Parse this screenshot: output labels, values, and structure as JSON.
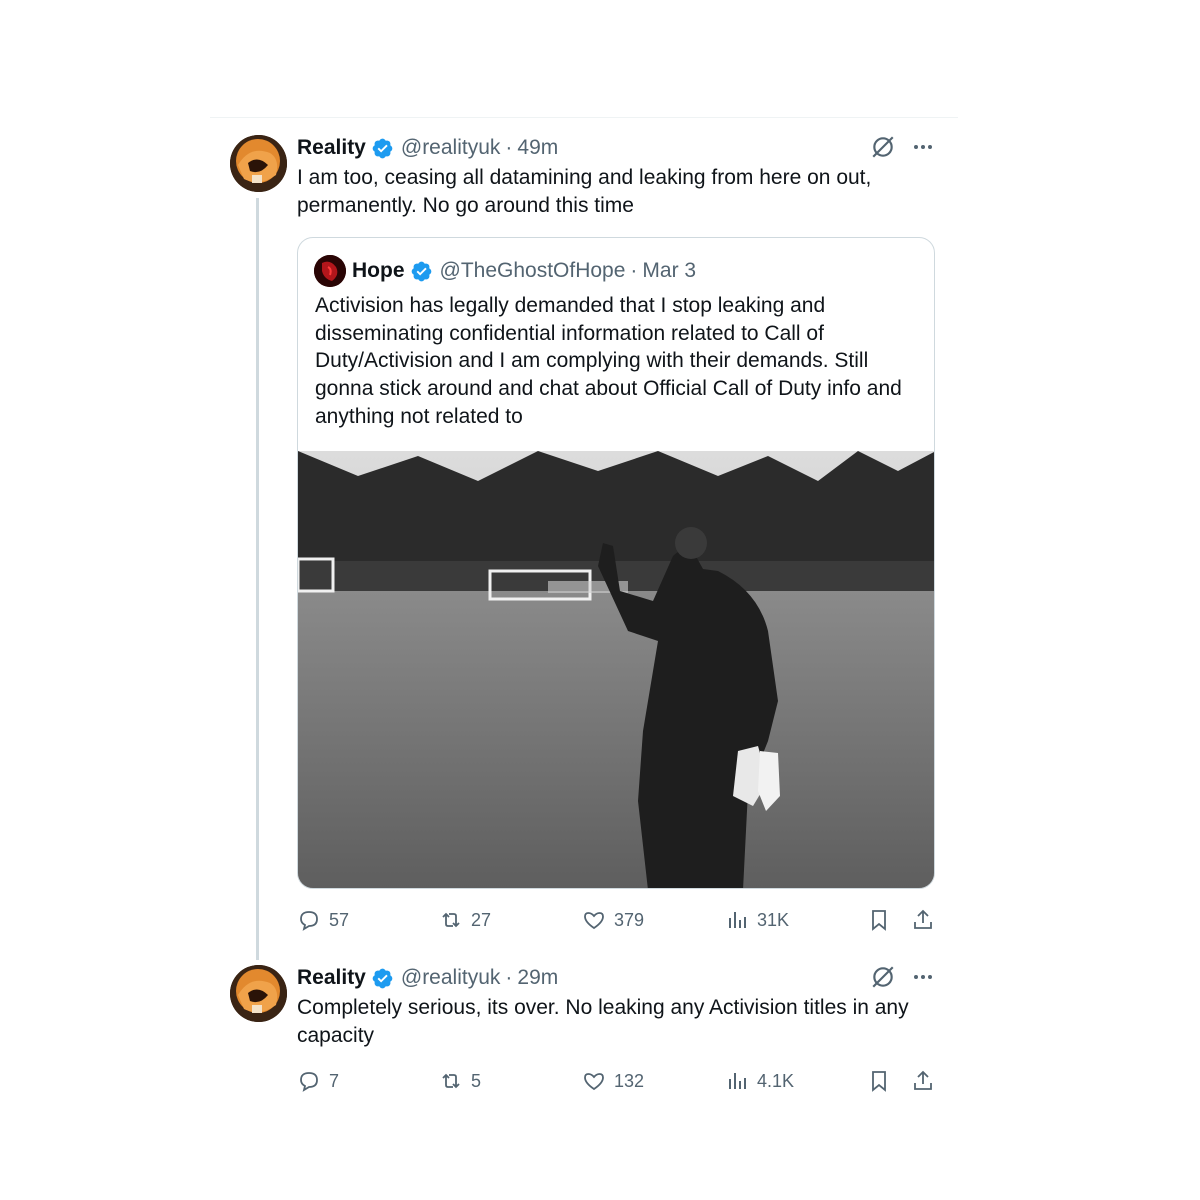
{
  "tweets": [
    {
      "author_name": "Reality",
      "handle": "@realityuk",
      "dot": "·",
      "time": "49m",
      "text": "I am too, ceasing all datamining and leaking from here on out, permanently. No go around this time",
      "quote": {
        "author_name": "Hope",
        "handle": "@TheGhostOfHope",
        "dot": "·",
        "time": "Mar 3",
        "text": "Activision has legally demanded that I stop leaking and disseminating confidential information related to Call of Duty/Activision and I am complying with their demands. Still gonna stick around and chat about Official Call of Duty info and anything not related to"
      },
      "stats": {
        "replies": "57",
        "reposts": "27",
        "likes": "379",
        "views": "31K"
      }
    },
    {
      "author_name": "Reality",
      "handle": "@realityuk",
      "dot": "·",
      "time": "29m",
      "text": "Completely serious, its over. No leaking any Activision titles in any capacity",
      "stats": {
        "replies": "7",
        "reposts": "5",
        "likes": "132",
        "views": "4.1K"
      }
    }
  ],
  "colors": {
    "verified": "#1d9bf0",
    "muted": "#536471",
    "text": "#0f1419",
    "border": "#cfd9de"
  },
  "icons": [
    "verified-badge-icon",
    "grok-icon",
    "more-icon",
    "reply-icon",
    "repost-icon",
    "like-icon",
    "views-icon",
    "bookmark-icon",
    "share-icon"
  ]
}
